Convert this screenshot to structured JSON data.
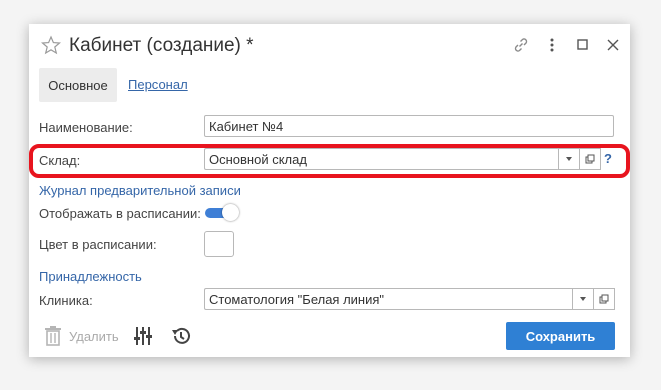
{
  "window": {
    "title": "Кабинет (создание) *"
  },
  "tabs": {
    "main": "Основное",
    "staff": "Персонал"
  },
  "form": {
    "name_label": "Наименование:",
    "name_value": "Кабинет №4",
    "warehouse_label": "Склад:",
    "warehouse_value": "Основной склад",
    "help_glyph": "?",
    "journal_section": "Журнал предварительной записи",
    "show_in_schedule_label": "Отображать в расписании:",
    "show_in_schedule": true,
    "schedule_color_label": "Цвет в расписании:",
    "belonging_section": "Принадлежность",
    "clinic_label": "Клиника:",
    "clinic_value": "Стоматология \"Белая линия\""
  },
  "footer": {
    "delete_label": "Удалить",
    "save_label": "Сохранить"
  },
  "colors": {
    "accent": "#2f80d4",
    "link": "#3566a8",
    "highlight": "#e8141e"
  }
}
